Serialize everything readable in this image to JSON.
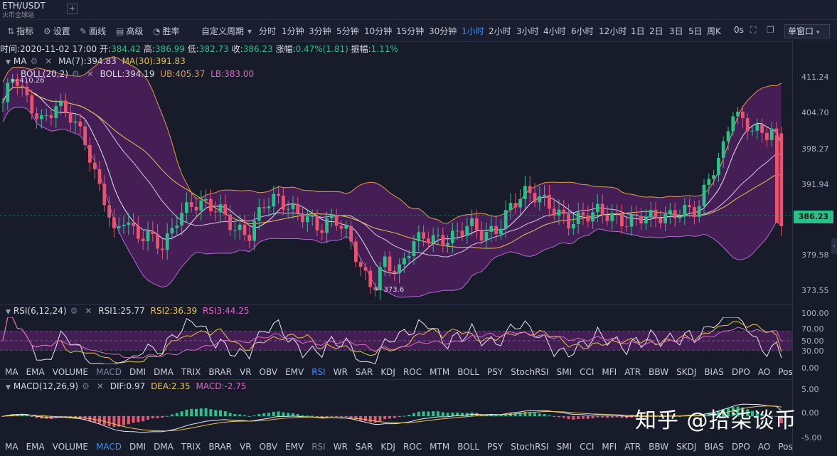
{
  "header": {
    "symbol": "ETH/USDT",
    "exchange": "火币全球站",
    "add_label": "+"
  },
  "toolbar": {
    "indicators": "指标",
    "settings": "设置",
    "draw": "画线",
    "advanced": "高级",
    "winrate": "胜率",
    "custom_period": "自定义周期",
    "periods": [
      "分时",
      "1分钟",
      "3分钟",
      "5分钟",
      "10分钟",
      "15分钟",
      "30分钟",
      "1小时",
      "2小时",
      "3小时",
      "4小时",
      "6小时",
      "12小时",
      "1日",
      "2日",
      "3日",
      "5日",
      "周K"
    ],
    "active_period": "1小时",
    "countdown": "0s",
    "window_mode": "单窗口"
  },
  "info": {
    "time_label": "时间:",
    "time": "2020-11-02 17:00",
    "open_label": "开:",
    "open": "384.42",
    "high_label": "高:",
    "high": "386.99",
    "low_label": "低:",
    "low": "382.73",
    "close_label": "收:",
    "close": "386.23",
    "change_label": "涨幅:",
    "change": "0.47%(1.81)",
    "amp_label": "振幅:",
    "amp": "1.11%"
  },
  "ma": {
    "name": "MA",
    "ma7": "MA(7):394.83",
    "ma30": "MA(30):391.83"
  },
  "boll": {
    "name": "BOLL(20,2)",
    "boll": "BOLL:394.19",
    "ub": "UB:405.37",
    "lb": "LB:383.00"
  },
  "annotations": {
    "high": "← 410.26",
    "low": "← 373.6"
  },
  "price_axis": {
    "ticks": [
      "411.24",
      "404.70",
      "398.27",
      "391.94",
      "386.23",
      "379.58",
      "373.55"
    ],
    "current": "386.23"
  },
  "rsi": {
    "name": "RSI(6,12,24)",
    "rsi1": "RSI1:25.77",
    "rsi2": "RSI2:36.39",
    "rsi3": "RSI3:44.25",
    "ticks": [
      "100.00",
      "70.00",
      "50.00",
      "30.00",
      "0.00"
    ]
  },
  "macd": {
    "name": "MACD(12,26,9)",
    "dif": "DIF:0.97",
    "dea": "DEA:2.35",
    "macd": "MACD:-2.75",
    "ticks": [
      "5.00",
      "0.00",
      "-5.00"
    ]
  },
  "indicator_tabs": [
    "MA",
    "EMA",
    "VOLUME",
    "MACD",
    "DMI",
    "DMA",
    "TRIX",
    "BRAR",
    "VR",
    "OBV",
    "EMV",
    "RSI",
    "WR",
    "SAR",
    "KDJ",
    "ROC",
    "MTM",
    "BOLL",
    "PSY",
    "StochRSI",
    "SMI",
    "CCI",
    "MFI",
    "ATR",
    "BBW",
    "SKDJ",
    "BIAS",
    "DPO",
    "AO",
    "Position"
  ],
  "selected_tab_1": "RSI",
  "selected_tab_2": "MACD",
  "watermark": "知乎 @拾柒谈币",
  "colors": {
    "bg": "#181b2a",
    "up": "#2bbf8a",
    "down": "#e9536e",
    "band": "#4a1f5a",
    "accent": "#3e8ef7"
  }
}
